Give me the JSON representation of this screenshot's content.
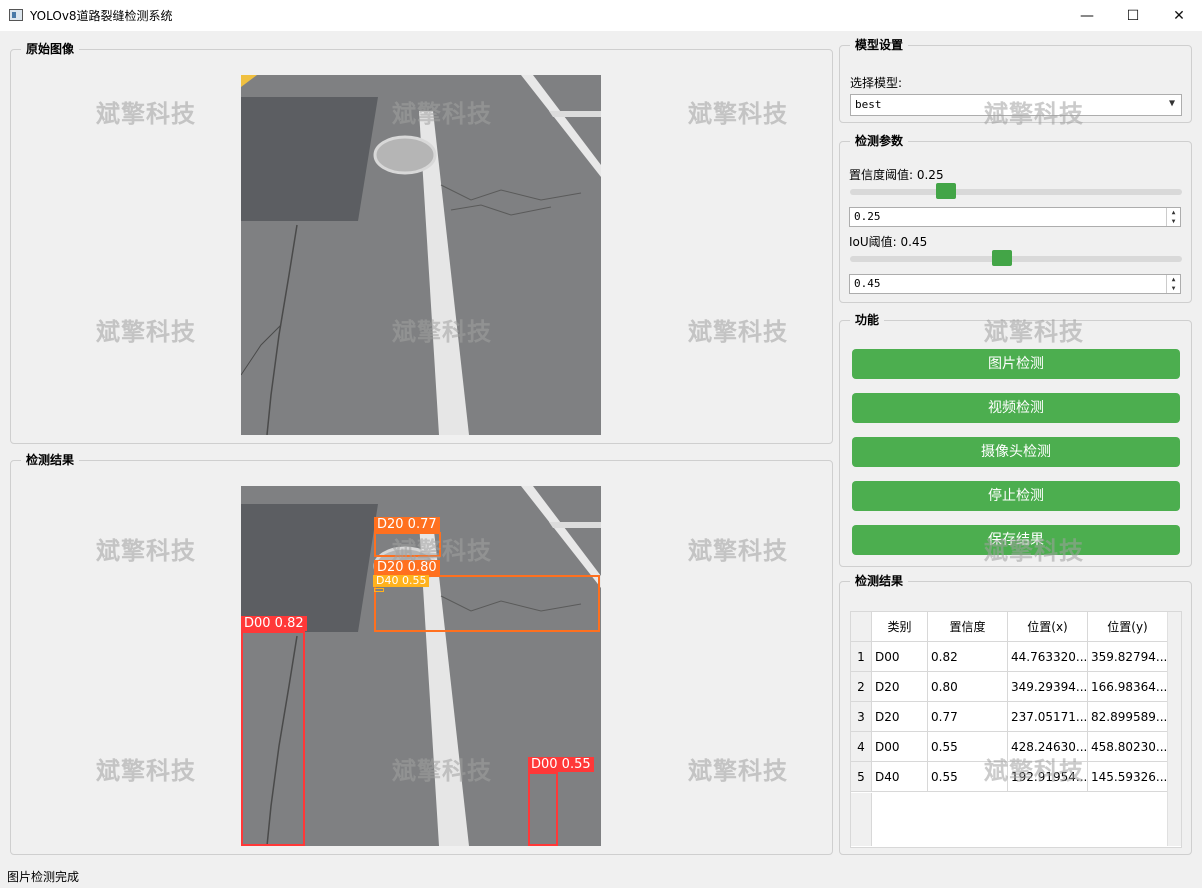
{
  "window": {
    "title": "YOLOv8道路裂缝检测系统",
    "minimize_glyph": "—",
    "maximize_glyph": "☐",
    "close_glyph": "✕"
  },
  "original_panel": {
    "title": "原始图像"
  },
  "result_panel": {
    "title": "检测结果"
  },
  "watermark": "斌擎科技",
  "detections": [
    {
      "label": "D20  0.77",
      "color": "#ff701f"
    },
    {
      "label": "D20  0.80",
      "color": "#ff701f"
    },
    {
      "label": "D40  0.55",
      "color": "#ffb21d"
    },
    {
      "label": "D00  0.82",
      "color": "#ff3838"
    },
    {
      "label": "D00  0.55",
      "color": "#ff3838"
    }
  ],
  "model_group": {
    "title": "模型设置",
    "select_label": "选择模型:",
    "selected_model": "best"
  },
  "params_group": {
    "title": "检测参数",
    "conf_label": "置信度阈值: 0.25",
    "conf_value": "0.25",
    "conf_level": 0.25,
    "iou_label": "IoU阈值: 0.45",
    "iou_value": "0.45",
    "iou_level": 0.45
  },
  "function_group": {
    "title": "功能",
    "buttons": [
      "图片检测",
      "视频检测",
      "摄像头检测",
      "停止检测",
      "保存结果"
    ]
  },
  "results_group": {
    "title": "检测结果",
    "columns": [
      "类别",
      "置信度",
      "位置(x)",
      "位置(y)"
    ],
    "rows": [
      {
        "n": "1",
        "cls": "D00",
        "conf": "0.82",
        "x": "44.763320...",
        "y": "359.82794..."
      },
      {
        "n": "2",
        "cls": "D20",
        "conf": "0.80",
        "x": "349.29394...",
        "y": "166.98364..."
      },
      {
        "n": "3",
        "cls": "D20",
        "conf": "0.77",
        "x": "237.05171...",
        "y": "82.899589..."
      },
      {
        "n": "4",
        "cls": "D00",
        "conf": "0.55",
        "x": "428.24630...",
        "y": "458.80230..."
      },
      {
        "n": "5",
        "cls": "D40",
        "conf": "0.55",
        "x": "192.91954...",
        "y": "145.59326..."
      }
    ]
  },
  "status": "图片检测完成",
  "colors": {
    "accent": "#4cae4f",
    "slider_handle": "#43a547"
  }
}
